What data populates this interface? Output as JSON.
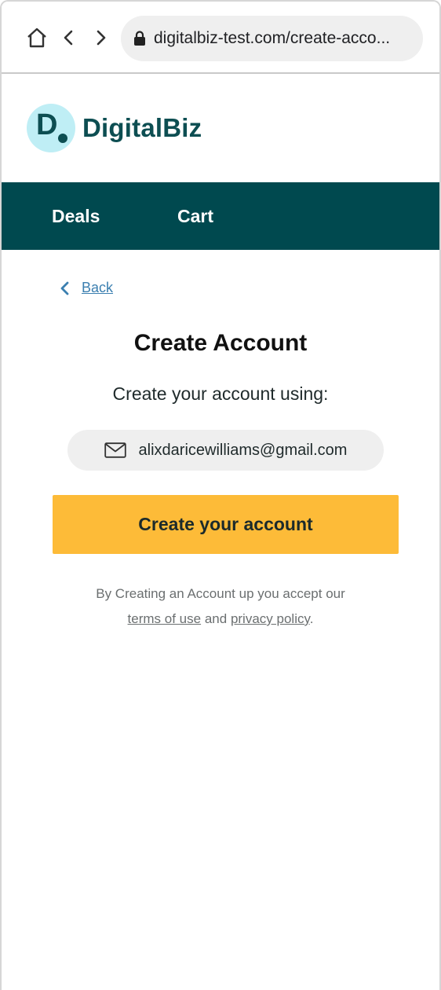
{
  "browser": {
    "url": "digitalbiz-test.com/create-acco...",
    "icons": {
      "home": "home-icon",
      "back": "chevron-left-icon",
      "forward": "chevron-right-icon",
      "lock": "lock-icon"
    }
  },
  "site": {
    "logo_letter": "D",
    "logo_name": "DigitalBiz",
    "brand_color": "#00494f",
    "logo_circle_color": "#bfeef5"
  },
  "nav": {
    "items": [
      {
        "label": "Deals"
      },
      {
        "label": "Cart"
      }
    ]
  },
  "page": {
    "back_label": "Back",
    "title": "Create Account",
    "subtitle": "Create your account using:",
    "email": "alixdaricewilliams@gmail.com",
    "email_icon": "mail-icon",
    "create_button_label": "Create your account",
    "create_button_color": "#fdbb38",
    "legal_prefix": "By Creating an Account up you accept our",
    "terms_link": "terms of use",
    "legal_and": "and",
    "privacy_link": "privacy policy",
    "legal_suffix": "."
  }
}
